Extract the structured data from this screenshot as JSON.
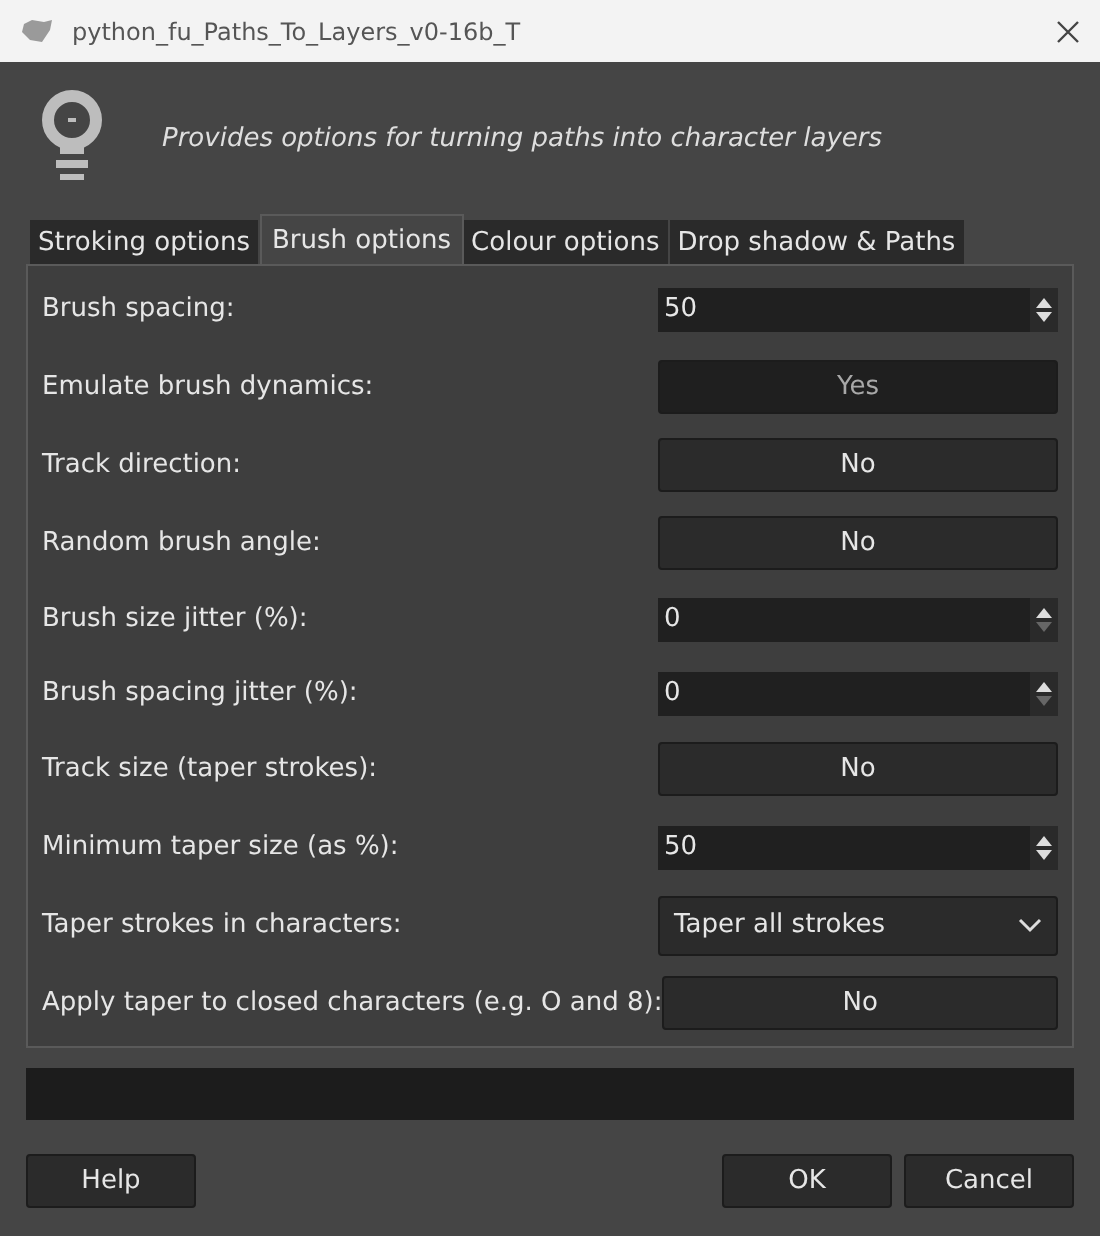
{
  "window": {
    "title": "python_fu_Paths_To_Layers_v0-16b_T"
  },
  "description": "Provides options for turning paths into character layers",
  "tabs": [
    {
      "label": "Stroking options",
      "selected": false
    },
    {
      "label": "Brush options",
      "selected": true
    },
    {
      "label": "Colour options",
      "selected": false
    },
    {
      "label": "Drop shadow & Paths",
      "selected": false
    }
  ],
  "options": [
    {
      "label": "Brush spacing:",
      "kind": "spin",
      "value": "50",
      "down_disabled": false
    },
    {
      "label": "Emulate brush dynamics:",
      "kind": "toggle",
      "value": "Yes",
      "on": true
    },
    {
      "label": "Track direction:",
      "kind": "toggle",
      "value": "No",
      "on": false
    },
    {
      "label": "Random brush angle:",
      "kind": "toggle",
      "value": "No",
      "on": false
    },
    {
      "label": "Brush size jitter (%):",
      "kind": "spin",
      "value": "0",
      "down_disabled": true
    },
    {
      "label": "Brush spacing jitter (%):",
      "kind": "spin",
      "value": "0",
      "down_disabled": true
    },
    {
      "label": "Track size (taper strokes):",
      "kind": "toggle",
      "value": "No",
      "on": false
    },
    {
      "label": "Minimum taper size (as %):",
      "kind": "spin",
      "value": "50",
      "down_disabled": false
    },
    {
      "label": "Taper strokes in characters:",
      "kind": "combo",
      "value": "Taper all strokes"
    },
    {
      "label": "Apply taper to closed characters (e.g. O and 8):",
      "kind": "toggle",
      "value": "No",
      "on": false
    }
  ],
  "buttons": {
    "left": [
      "Help"
    ],
    "right": [
      "OK",
      "Cancel"
    ]
  }
}
